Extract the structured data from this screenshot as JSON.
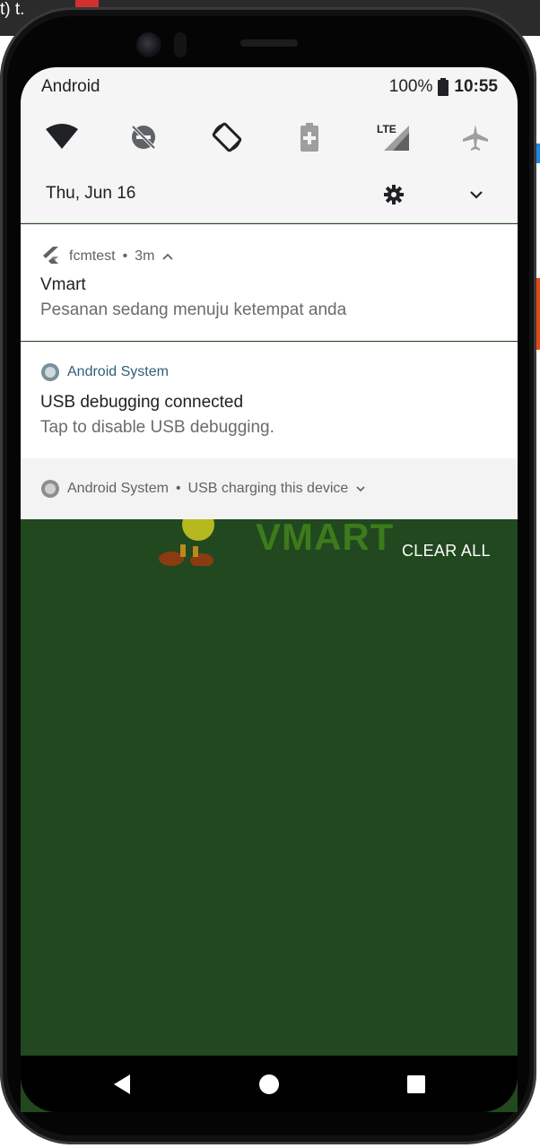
{
  "host": {
    "fragment_text": "t) t."
  },
  "status_bar": {
    "left_label": "Android",
    "battery": "100%",
    "time": "10:55"
  },
  "quick_settings": {
    "tiles": [
      {
        "name": "wifi-icon"
      },
      {
        "name": "do-not-disturb-off-icon"
      },
      {
        "name": "auto-rotate-icon"
      },
      {
        "name": "battery-saver-icon"
      },
      {
        "name": "mobile-data-lte-icon",
        "label": "LTE"
      },
      {
        "name": "airplane-mode-icon"
      }
    ],
    "date": "Thu, Jun 16"
  },
  "notifications": [
    {
      "app": "fcmtest",
      "age": "3m",
      "title": "Vmart",
      "text": "Pesanan  sedang menuju ketempat anda"
    },
    {
      "app": "Android System",
      "title": "USB debugging connected",
      "text": "Tap to disable USB debugging."
    },
    {
      "app": "Android System",
      "summary": "USB charging this device"
    }
  ],
  "clear_all_label": "CLEAR ALL",
  "colors": {
    "wallpaper": "#21481f",
    "shade": "#f5f5f5",
    "accent_blue": "#2f5f78"
  }
}
